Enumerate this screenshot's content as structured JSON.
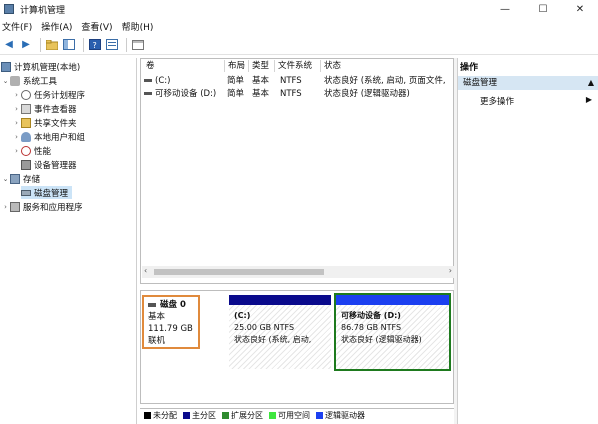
{
  "window": {
    "title": "计算机管理",
    "min_label": "—",
    "max_label": "☐",
    "close_label": "✕"
  },
  "menu": [
    "文件(F)",
    "操作(A)",
    "查看(V)",
    "帮助(H)"
  ],
  "tree": {
    "root": "计算机管理(本地)",
    "system_tools": "系统工具",
    "task_scheduler": "任务计划程序",
    "event_viewer": "事件查看器",
    "shared_folders": "共享文件夹",
    "local_users": "本地用户和组",
    "performance": "性能",
    "device_manager": "设备管理器",
    "storage": "存储",
    "disk_management": "磁盘管理",
    "services": "服务和应用程序"
  },
  "volumes": {
    "headers": [
      "卷",
      "布局",
      "类型",
      "文件系统",
      "状态"
    ],
    "rows": [
      {
        "name": "(C:)",
        "layout": "简单",
        "type": "基本",
        "fs": "NTFS",
        "status": "状态良好 (系统, 启动, 页面文件,"
      },
      {
        "name": "可移动设备 (D:)",
        "layout": "简单",
        "type": "基本",
        "fs": "NTFS",
        "status": "状态良好 (逻辑驱动器)"
      }
    ]
  },
  "disk": {
    "name": "磁盘 0",
    "type": "基本",
    "size": "111.79 GB",
    "state": "联机",
    "partitions": [
      {
        "label": "(C:)",
        "size": "25.00 GB NTFS",
        "status": "状态良好 (系统, 启动,"
      },
      {
        "label": "可移动设备 (D:)",
        "size": "86.78 GB NTFS",
        "status": "状态良好 (逻辑驱动器)"
      }
    ]
  },
  "legend": [
    {
      "label": "未分配",
      "color": "#000000"
    },
    {
      "label": "主分区",
      "color": "#0a0a8c"
    },
    {
      "label": "扩展分区",
      "color": "#2e8b2e"
    },
    {
      "label": "可用空间",
      "color": "#3ee63e"
    },
    {
      "label": "逻辑驱动器",
      "color": "#1b3ff0"
    }
  ],
  "actions": {
    "header": "操作",
    "section": "磁盘管理",
    "more": "更多操作"
  }
}
